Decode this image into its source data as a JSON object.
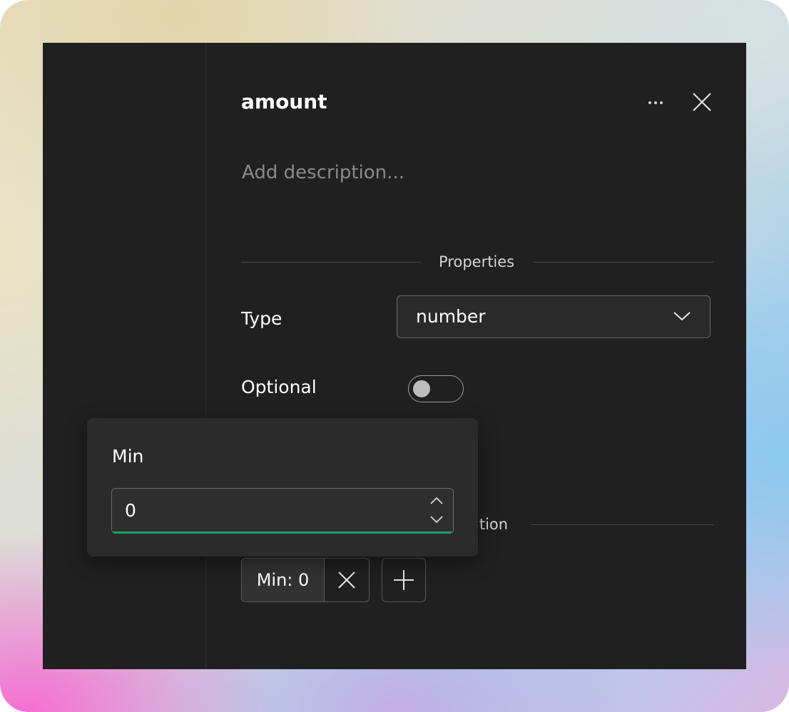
{
  "panel": {
    "title": "amount",
    "description_placeholder": "Add description..."
  },
  "sections": {
    "properties": "Properties",
    "validation_partial": "ation"
  },
  "properties": {
    "type_label": "Type",
    "type_value": "number",
    "optional_label": "Optional",
    "optional_on": false
  },
  "validation": {
    "chip_label": "Min: 0"
  },
  "popover": {
    "label": "Min",
    "value": "0"
  },
  "icons": {
    "more": "more-horizontal-icon",
    "close": "close-icon",
    "dropdown": "chevron-down-icon",
    "remove": "close-icon",
    "add": "plus-icon",
    "spin_up": "chevron-up-icon",
    "spin_down": "chevron-down-icon"
  },
  "colors": {
    "window_bg": "#202020",
    "popover_bg": "#2b2b2b",
    "accent": "#1f9e6e"
  }
}
